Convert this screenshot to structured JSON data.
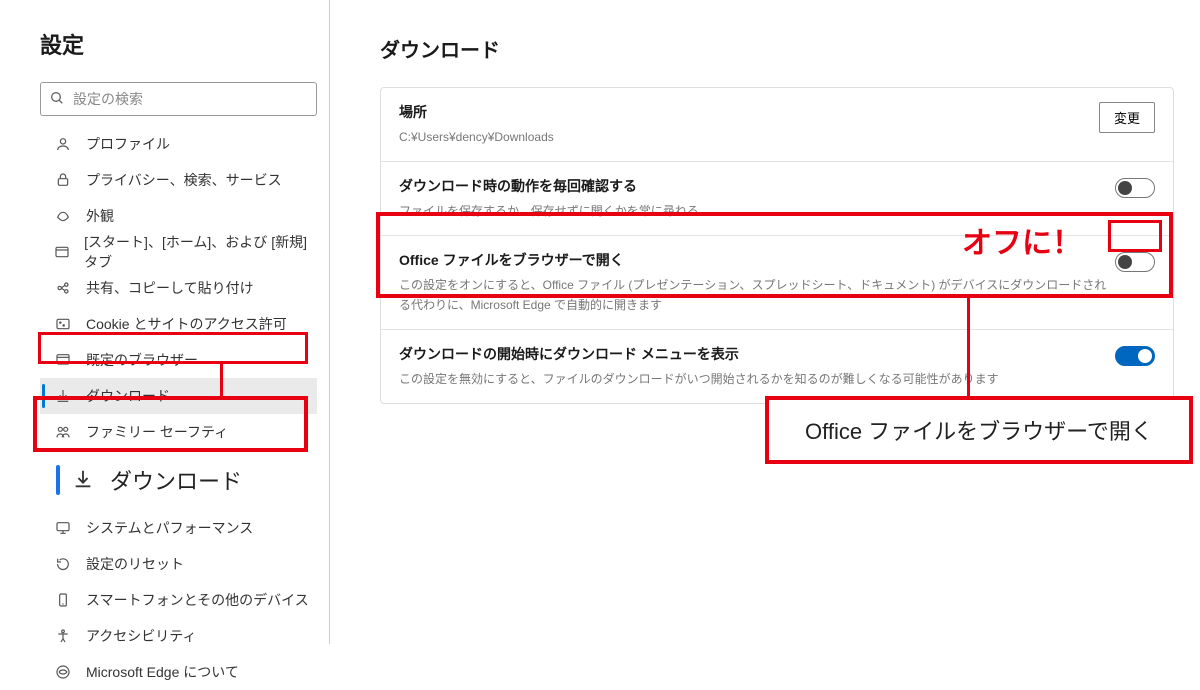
{
  "sidebar": {
    "title": "設定",
    "search_placeholder": "設定の検索",
    "items": [
      {
        "icon": "profile-icon",
        "label": "プロファイル"
      },
      {
        "icon": "lock-icon",
        "label": "プライバシー、検索、サービス"
      },
      {
        "icon": "appearance-icon",
        "label": "外観"
      },
      {
        "icon": "tabs-icon",
        "label": "[スタート]、[ホーム]、および [新規] タブ"
      },
      {
        "icon": "share-icon",
        "label": "共有、コピーして貼り付け"
      },
      {
        "icon": "cookie-icon",
        "label": "Cookie とサイトのアクセス許可"
      },
      {
        "icon": "default-browser-icon",
        "label": "既定のブラウザー"
      },
      {
        "icon": "download-icon",
        "label": "ダウンロード"
      },
      {
        "icon": "family-icon",
        "label": "ファミリー セーフティ"
      },
      {
        "icon": "system-icon",
        "label": "システムとパフォーマンス"
      },
      {
        "icon": "reset-icon",
        "label": "設定のリセット"
      },
      {
        "icon": "phone-icon",
        "label": "スマートフォンとその他のデバイス"
      },
      {
        "icon": "accessibility-icon",
        "label": "アクセシビリティ"
      },
      {
        "icon": "about-icon",
        "label": "Microsoft Edge について"
      }
    ],
    "big_item_label": "ダウンロード"
  },
  "main": {
    "title": "ダウンロード",
    "location": {
      "heading": "場所",
      "path": "C:¥Users¥dency¥Downloads",
      "change_label": "変更"
    },
    "ask_each_time": {
      "heading": "ダウンロード時の動作を毎回確認する",
      "desc": "ファイルを保存するか、保存せずに開くかを常に尋ねる",
      "state": "off"
    },
    "office_open": {
      "heading": "Office ファイルをブラウザーで開く",
      "desc": "この設定をオンにすると、Office ファイル (プレゼンテーション、スプレッドシート、ドキュメント) がデバイスにダウンロードされる代わりに、Microsoft Edge で自動的に開きます",
      "state": "off"
    },
    "show_menu": {
      "heading": "ダウンロードの開始時にダウンロード メニューを表示",
      "desc": "この設定を無効にすると、ファイルのダウンロードがいつ開始されるかを知るのが難しくなる可能性があります",
      "state": "on"
    }
  },
  "annotations": {
    "off_label": "オフに！",
    "callout_text": "Office ファイルをブラウザーで開く"
  }
}
